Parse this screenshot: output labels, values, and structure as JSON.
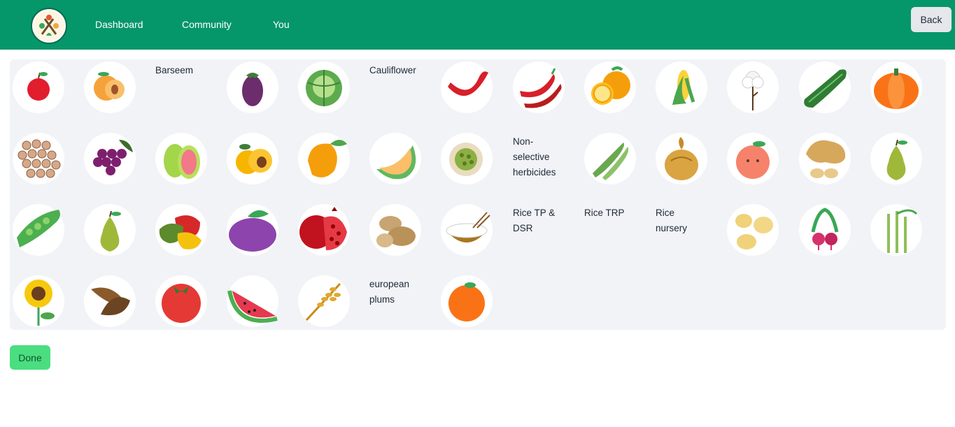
{
  "nav": {
    "links": [
      "Dashboard",
      "Community",
      "You"
    ],
    "back_label": "Back"
  },
  "crops": [
    {
      "icon": "apple-icon"
    },
    {
      "icon": "apricot-icon"
    },
    {
      "label": "Barseem"
    },
    {
      "icon": "brinjal-icon"
    },
    {
      "icon": "cabbage-icon"
    },
    {
      "label": "Cauliflower"
    },
    {
      "icon": "red-chilli-icon"
    },
    {
      "icon": "chilli-pair-icon"
    },
    {
      "icon": "orange-citrus-icon"
    },
    {
      "icon": "corn-icon"
    },
    {
      "icon": "cotton-icon"
    },
    {
      "icon": "cucumber-icon"
    },
    {
      "icon": "pumpkin-icon"
    },
    {
      "icon": "gram-seeds-icon"
    },
    {
      "icon": "grapes-icon"
    },
    {
      "icon": "guava-icon"
    },
    {
      "icon": "loquat-icon"
    },
    {
      "icon": "mango-icon"
    },
    {
      "icon": "melon-slice-icon"
    },
    {
      "icon": "moong-bean-icon"
    },
    {
      "label": "Non-selective herbicides"
    },
    {
      "icon": "okra-icon"
    },
    {
      "icon": "onion-icon"
    },
    {
      "icon": "peach-icon"
    },
    {
      "icon": "peanut-icon"
    },
    {
      "icon": "pear-icon"
    },
    {
      "icon": "peas-icon"
    },
    {
      "icon": "pear-icon"
    },
    {
      "icon": "bell-pepper-icon"
    },
    {
      "icon": "plum-icon"
    },
    {
      "icon": "pomegranate-icon"
    },
    {
      "icon": "potato-icon"
    },
    {
      "icon": "rice-bowl-icon"
    },
    {
      "label": "Rice TP & DSR"
    },
    {
      "label": "Rice TRP"
    },
    {
      "label": "Rice nursery"
    },
    {
      "icon": "soybean-icon"
    },
    {
      "icon": "radish-icon"
    },
    {
      "icon": "sugarcane-icon"
    },
    {
      "icon": "sunflower-icon"
    },
    {
      "icon": "tobacco-leaf-icon"
    },
    {
      "icon": "tomato-icon"
    },
    {
      "icon": "watermelon-icon"
    },
    {
      "icon": "wheat-icon"
    },
    {
      "label": "european plums"
    },
    {
      "icon": "orange-icon"
    }
  ],
  "done_label": "Done",
  "colors": {
    "header": "#05966a",
    "done": "#4ade80",
    "panel": "#f1f3f7"
  }
}
